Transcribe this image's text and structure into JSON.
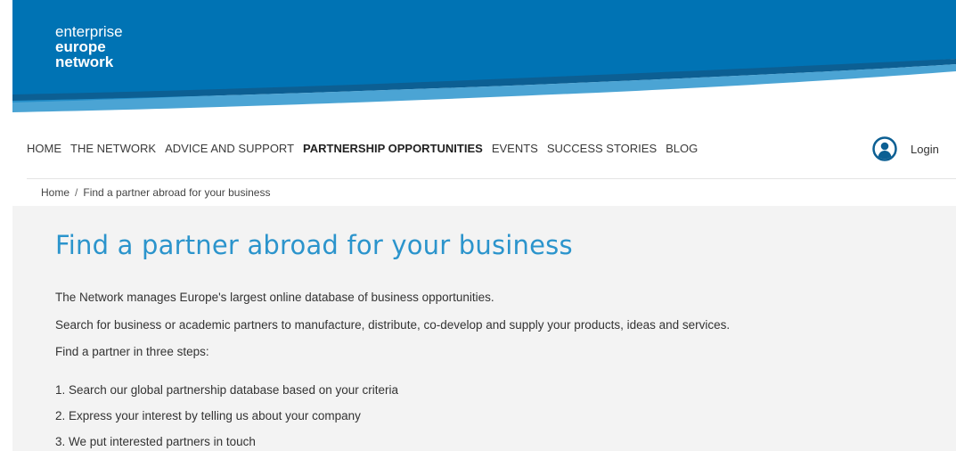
{
  "brand": {
    "line1": "enterprise",
    "line2": "europe",
    "line3": "network",
    "color_primary": "#0073b4",
    "color_accent": "#2b94cc"
  },
  "nav": {
    "items": [
      {
        "label": "HOME"
      },
      {
        "label": "THE NETWORK"
      },
      {
        "label": "ADVICE AND SUPPORT"
      },
      {
        "label": "PARTNERSHIP OPPORTUNITIES"
      },
      {
        "label": "EVENTS"
      },
      {
        "label": "SUCCESS STORIES"
      },
      {
        "label": "BLOG"
      }
    ],
    "active_index": 3,
    "login_label": "Login",
    "login_icon": "user-circle-icon"
  },
  "breadcrumb": {
    "home": "Home",
    "separator": "/",
    "current": "Find a partner abroad for your business"
  },
  "main": {
    "title": "Find a partner abroad for your business",
    "paragraphs": [
      "The Network manages Europe's largest online database of business opportunities.",
      "Search for business or academic partners to manufacture, distribute, co-develop and supply your products, ideas and services.",
      "Find a partner in three steps:"
    ],
    "steps": [
      "1. Search our global partnership database based on your criteria",
      "2. Express your interest by telling us about your company",
      "3. We put interested partners in touch"
    ]
  }
}
